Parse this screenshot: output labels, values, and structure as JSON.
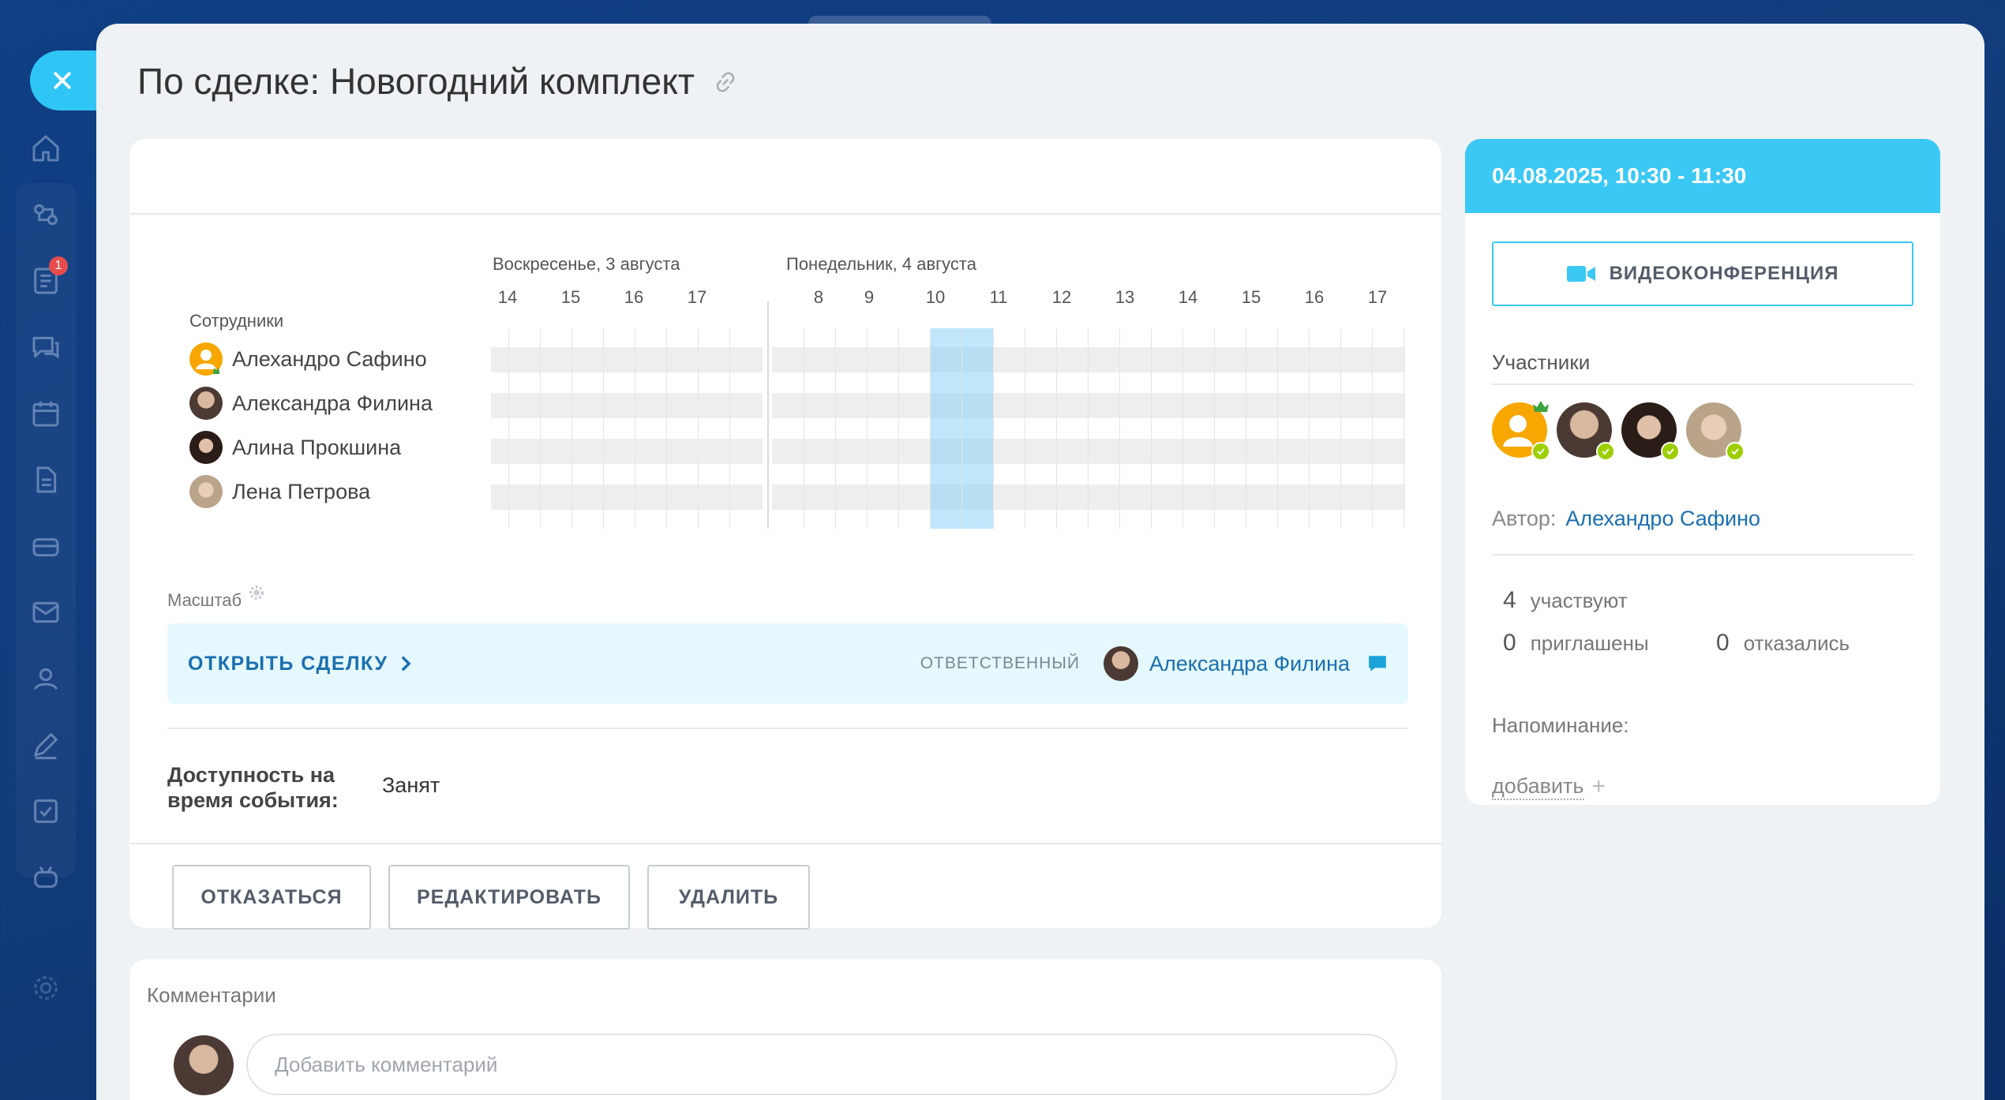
{
  "sidebar": {
    "notification_count": "1",
    "icons": [
      "home-icon",
      "sync-icon",
      "tasks-icon",
      "chat-icon",
      "calendar-icon",
      "document-icon",
      "inbox-icon",
      "mail-icon",
      "contacts-icon",
      "signature-icon",
      "checkbox-icon",
      "robot-icon",
      "settings-icon"
    ]
  },
  "page": {
    "title": "По сделке: Новогодний комплект"
  },
  "planner": {
    "employees_header": "Сотрудники",
    "days": [
      {
        "label": "Воскресенье, 3 августа",
        "hours": [
          "14",
          "15",
          "16",
          "17"
        ]
      },
      {
        "label": "Понедельник, 4 августа",
        "hours": [
          "8",
          "9",
          "10",
          "11",
          "12",
          "13",
          "14",
          "15",
          "16",
          "17"
        ]
      }
    ],
    "employees": [
      {
        "name": "Алехандро Сафино",
        "avatar": "default-user-icon"
      },
      {
        "name": "Александра Филина",
        "avatar": "photo"
      },
      {
        "name": "Алина Прокшина",
        "avatar": "photo"
      },
      {
        "name": "Лена Петрова",
        "avatar": "photo"
      }
    ],
    "scale_label": "Масштаб"
  },
  "deal": {
    "open_label": "ОТКРЫТЬ СДЕЛКУ",
    "responsible_label": "ОТВЕТСТВЕННЫЙ",
    "responsible_name": "Александра Филина"
  },
  "availability": {
    "label": "Доступность на время события:",
    "value": "Занят"
  },
  "actions": {
    "decline": "ОТКАЗАТЬСЯ",
    "edit": "РЕДАКТИРОВАТЬ",
    "delete": "УДАЛИТЬ"
  },
  "comments": {
    "title": "Комментарии",
    "placeholder": "Добавить комментарий"
  },
  "event": {
    "datetime": "04.08.2025, 10:30 - 11:30",
    "video_label": "ВИДЕОКОНФЕРЕНЦИЯ",
    "participants_title": "Участники",
    "author_label": "Автор:",
    "author_name": "Алехандро Сафино",
    "stats": {
      "attending_count": "4",
      "attending_label": "участвуют",
      "invited_count": "0",
      "invited_label": "приглашены",
      "declined_count": "0",
      "declined_label": "отказались"
    },
    "reminder_label": "Напоминание:",
    "add_reminder": "добавить",
    "add_reminder_plus": "+"
  },
  "colors": {
    "accent": "#2fc6f6",
    "link": "#1a6fb0",
    "accepted": "#9dcf00",
    "selection": "#8cd2f5"
  }
}
